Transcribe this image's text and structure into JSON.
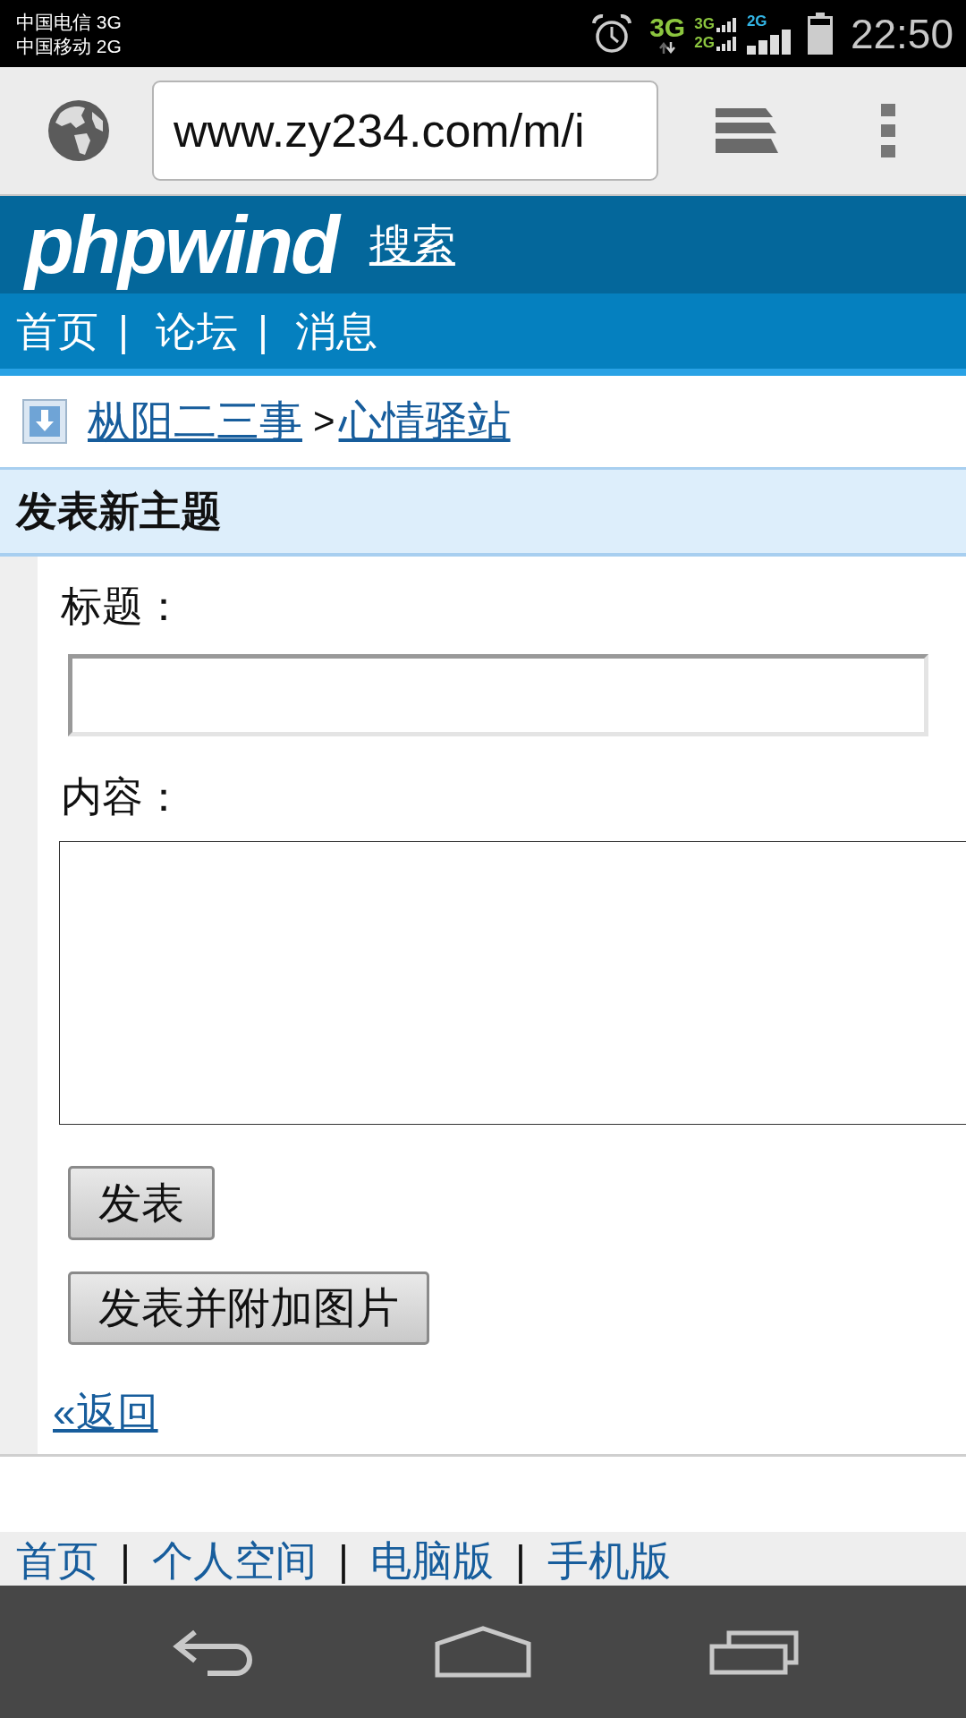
{
  "status_bar": {
    "carriers": [
      "中国电信 3G",
      "中国移动 2G"
    ],
    "data_type": "3G",
    "sim_signals": [
      {
        "label": "3G"
      },
      {
        "label": "2G"
      }
    ],
    "second_signal_label": "2G",
    "time": "22:50"
  },
  "browser": {
    "url": "www.zy234.com/m/i"
  },
  "header": {
    "logo": "phpwind",
    "search_link": "搜索"
  },
  "nav": [
    {
      "label": "首页",
      "separator": "|"
    },
    {
      "label": "论坛",
      "separator": "|"
    },
    {
      "label": "消息"
    }
  ],
  "breadcrumb": {
    "links": [
      "枞阳二三事",
      "心情驿站"
    ],
    "separator": ">"
  },
  "form": {
    "title": "发表新主题",
    "fields": [
      {
        "kind": "input",
        "label": "标题："
      },
      {
        "kind": "textarea",
        "label": "内容："
      }
    ],
    "buttons": [
      "发表",
      "发表并附加图片"
    ],
    "back_link": "«返回"
  },
  "footer": [
    {
      "label": "首页",
      "separator": "|"
    },
    {
      "label": "个人空间",
      "separator": "|"
    },
    {
      "label": "电脑版",
      "separator": "|"
    },
    {
      "label": "手机版"
    }
  ]
}
